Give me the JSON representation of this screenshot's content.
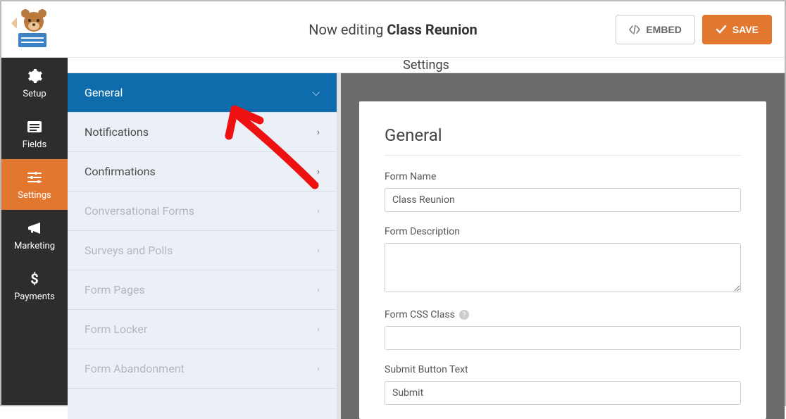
{
  "header": {
    "prefix": "Now editing",
    "form_name": "Class Reunion",
    "embed_label": "EMBED",
    "save_label": "SAVE"
  },
  "rail": {
    "setup": "Setup",
    "fields": "Fields",
    "settings": "Settings",
    "marketing": "Marketing",
    "payments": "Payments"
  },
  "section_title": "Settings",
  "settings_list": {
    "general": "General",
    "notifications": "Notifications",
    "confirmations": "Confirmations",
    "conversational": "Conversational Forms",
    "surveys": "Surveys and Polls",
    "formpages": "Form Pages",
    "formlocker": "Form Locker",
    "formabandonment": "Form Abandonment"
  },
  "preview": {
    "title": "General",
    "labels": {
      "form_name": "Form Name",
      "form_description": "Form Description",
      "form_css": "Form CSS Class",
      "submit_text": "Submit Button Text"
    },
    "values": {
      "form_name": "Class Reunion",
      "submit_text": "Submit"
    }
  }
}
